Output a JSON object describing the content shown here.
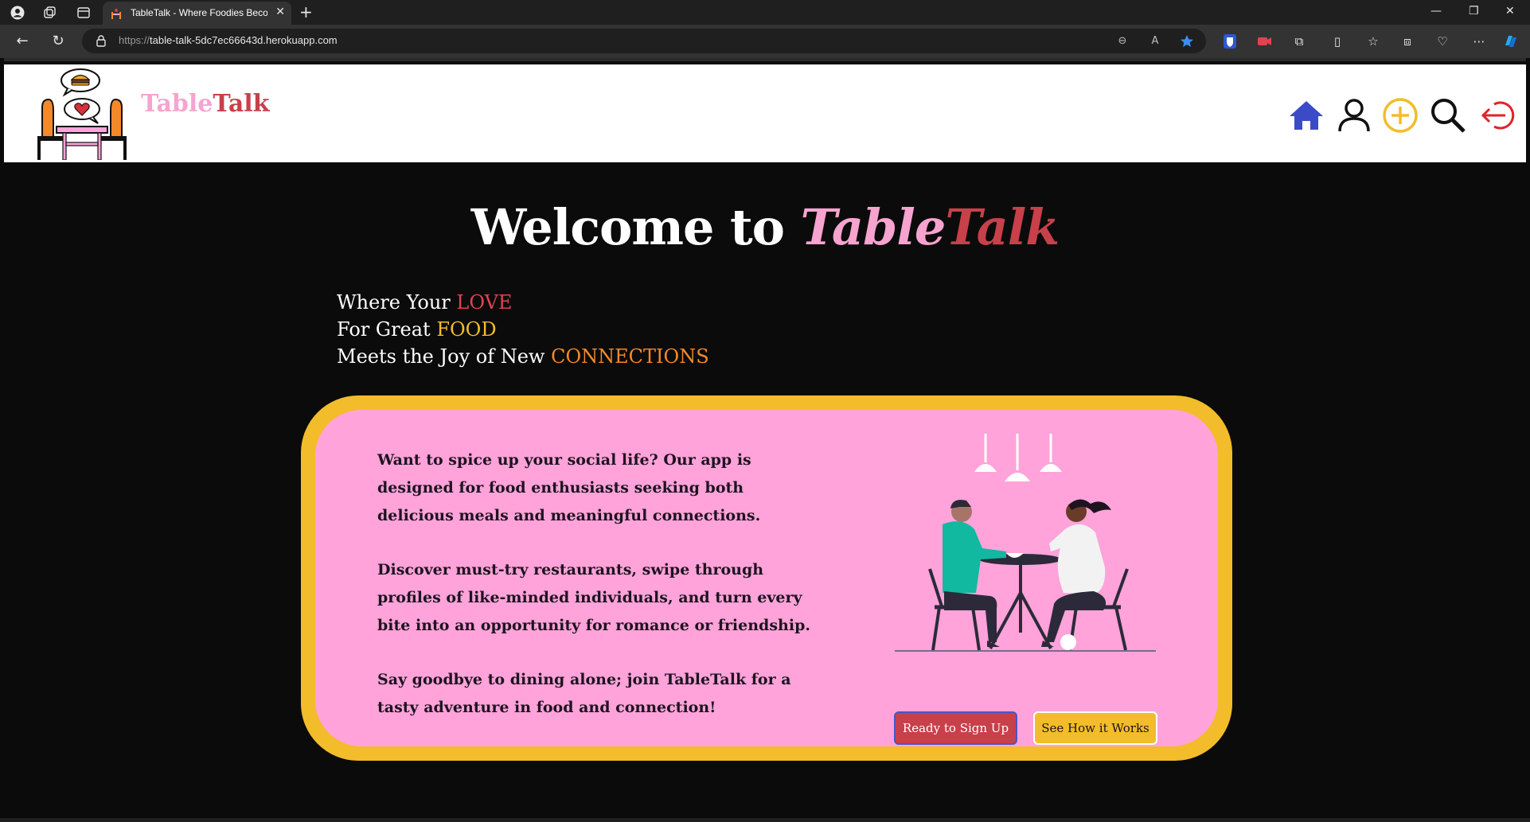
{
  "browser": {
    "tab_title": "TableTalk - Where Foodies Becom",
    "url_scheme": "https://",
    "url_host": "table-talk-5dc7ec66643d.herokuapp.com"
  },
  "header": {
    "brand_part1": "Table",
    "brand_part2": "Talk",
    "nav_icons": [
      "home-icon",
      "profile-icon",
      "add-icon",
      "search-icon",
      "logout-icon"
    ]
  },
  "hero": {
    "welcome_prefix": "Welcome to ",
    "welcome_brand1": "Table",
    "welcome_brand2": "Talk",
    "lines": [
      {
        "text": "Where Your ",
        "highlight": "LOVE"
      },
      {
        "text": "For Great ",
        "highlight": "FOOD"
      },
      {
        "text": "Meets the Joy of New ",
        "highlight": "CONNECTIONS"
      }
    ]
  },
  "card": {
    "para1": "Want to spice up your social life? Our app is designed for food enthusiasts seeking both delicious meals and meaningful connections.",
    "para2": "Discover must-try restaurants, swipe through profiles of like-minded individuals, and turn every bite into an opportunity for romance or friendship.",
    "para3": "Say goodbye to dining alone; join TableTalk for a tasty adventure in food and connection!",
    "signup_label": "Ready to Sign Up",
    "how_label": "See How it Works"
  },
  "colors": {
    "pink": "#ffa3da",
    "brand_pink": "#f7a3cf",
    "brand_red": "#c8404a",
    "yellow": "#f3bc2a",
    "orange": "#f4892a",
    "nav_blue": "#3b4bc8",
    "logout_red": "#e0232a"
  }
}
